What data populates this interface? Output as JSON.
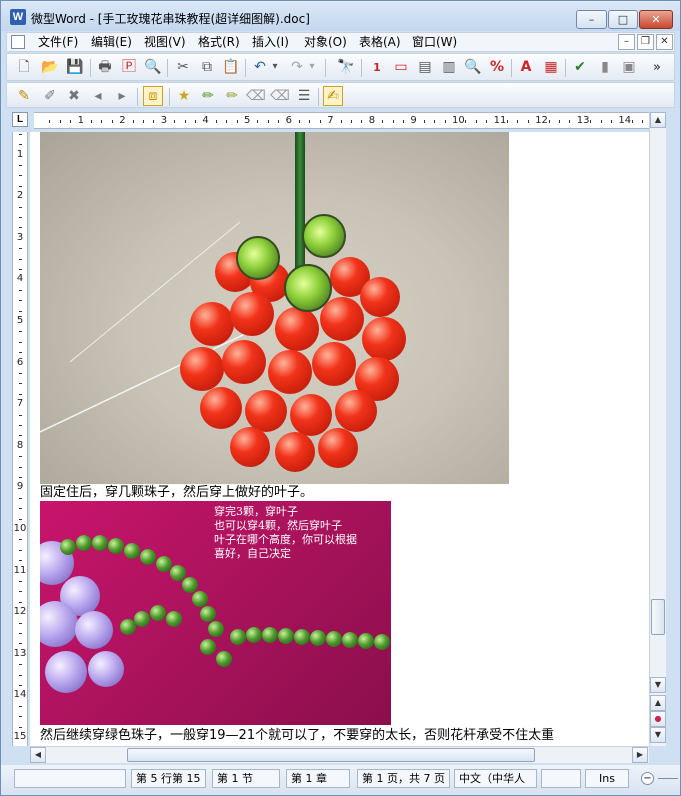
{
  "window": {
    "app_icon": "W",
    "title": "微型Word - [手工玫瑰花串珠教程(超详细图解).doc]",
    "minimize": "–",
    "maximize": "□",
    "close": "✕"
  },
  "menubar": {
    "items": [
      "文件(F)",
      "编辑(E)",
      "视图(V)",
      "格式(R)",
      "插入(I)",
      "对象(O)",
      "表格(A)",
      "窗口(W)"
    ],
    "mdi_minimize": "–",
    "mdi_restore": "❐",
    "mdi_close": "✕"
  },
  "toolbar1": {
    "icons": [
      "new-doc-icon",
      "open-folder-icon",
      "save-icon",
      "print-icon",
      "pdf-export-icon",
      "print-preview-icon",
      "cut-icon",
      "copy-icon",
      "paste-icon",
      "undo-icon",
      "undo-dropdown-icon",
      "redo-icon",
      "redo-dropdown-icon",
      "find-binoculars-icon",
      "insert-page-number-icon",
      "insert-field-icon",
      "insert-header-icon",
      "insert-columns-icon",
      "zoom-icon",
      "percent-icon",
      "font-color-icon",
      "text-box-icon",
      "spell-check-icon",
      "chart-icon",
      "duplicate-icon",
      "overflow-chevron-icon"
    ],
    "glyphs": [
      "🗋",
      "📂",
      "💾",
      "🖶",
      "🄿",
      "🔍",
      "✂",
      "⧉",
      "📋",
      "↶",
      "▾",
      "↷",
      "▾",
      "🔭",
      "1",
      "▭",
      "▤",
      "▥",
      "🔍",
      "%",
      "A",
      "▦",
      "✔",
      "▮",
      "▣",
      "»"
    ]
  },
  "toolbar2": {
    "icons": [
      "track-changes-icon",
      "edit-note-icon",
      "delete-note-icon",
      "prev-note-icon",
      "next-note-icon",
      "accept-icon",
      "star-mark-icon",
      "pencil-mark-icon",
      "pencil2-mark-icon",
      "eraser-mark-icon",
      "eraser2-mark-icon",
      "review-pane-icon",
      "highlighter-icon"
    ],
    "glyphs": [
      "✎",
      "✐",
      "✖",
      "◂",
      "▸",
      "⧈",
      "★",
      "✏",
      "✏",
      "⌫",
      "⌫",
      "☰",
      "✍"
    ]
  },
  "ruler": {
    "corner": "L",
    "h_numbers": [
      "1",
      "2",
      "3",
      "4",
      "5",
      "6",
      "7",
      "8",
      "9",
      "10",
      "11",
      "12",
      "13",
      "14"
    ],
    "v_numbers": [
      "1",
      "2",
      "3",
      "4",
      "5",
      "6",
      "7",
      "8",
      "9",
      "10",
      "11",
      "12",
      "13",
      "14",
      "15"
    ]
  },
  "document": {
    "caption1": "固定住后，穿几颗珠子，然后穿上做好的叶子。",
    "image2_note": [
      "穿完3颗，穿叶子",
      "也可以穿4颗，然后穿叶子",
      "叶子在哪个高度，你可以根据",
      "喜好，自己决定"
    ],
    "caption2": "然后继续穿绿色珠子，一般穿19—21个就可以了，不要穿的太长，否则花杆承受不住太重"
  },
  "scrollbars": {
    "up": "▲",
    "down": "▼",
    "prev_page": "▲",
    "browse": "●",
    "next_page": "▼",
    "left": "◀",
    "right": "▶"
  },
  "status": {
    "cells": [
      "",
      "第 5 行第 15",
      "第 1 节",
      "第 1 章",
      "第 1 页，共 7 页",
      "中文（中华人",
      "",
      "Ins"
    ],
    "zoom_minus": "−"
  }
}
